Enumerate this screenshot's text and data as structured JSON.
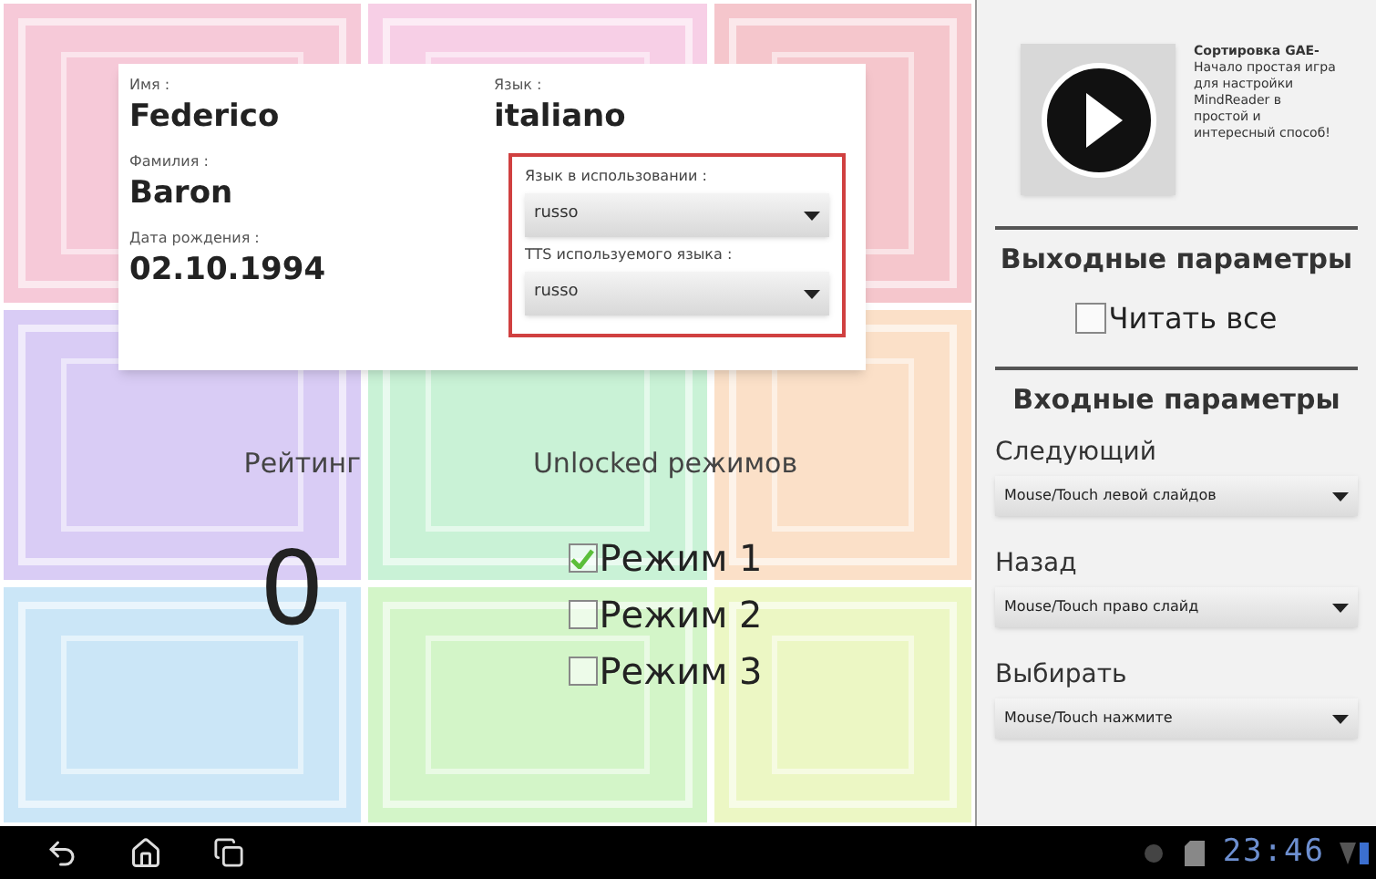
{
  "profile": {
    "fields": [
      {
        "label": "Имя :",
        "value": "Federico"
      },
      {
        "label": "Фамилия :",
        "value": "Baron"
      },
      {
        "label": "Дата рождения :",
        "value": "02.10.1994"
      }
    ],
    "language": {
      "label": "Язык :",
      "value": "italiano"
    },
    "language_settings": [
      {
        "label": "Язык в использовании :",
        "value": "russo"
      },
      {
        "label": "TTS используемого языка :",
        "value": "russo"
      }
    ]
  },
  "rating": {
    "label": "Рейтинг",
    "value": "0"
  },
  "modes": {
    "title": "Unlocked режимов",
    "items": [
      {
        "label": "Режим 1",
        "checked": true
      },
      {
        "label": "Режим 2",
        "checked": false
      },
      {
        "label": "Режим 3",
        "checked": false
      }
    ]
  },
  "sidebar": {
    "game": {
      "title": "Сортировка GAE-",
      "description": "Начало простая игра для настройки MindReader в простой и интересный способ!"
    },
    "output": {
      "title": "Выходные параметры",
      "read_all": {
        "label": "Читать все",
        "checked": false
      }
    },
    "input": {
      "title": "Входные параметры",
      "settings": [
        {
          "label": "Следующий",
          "value": "Mouse/Touch левой слайдов"
        },
        {
          "label": "Назад",
          "value": "Mouse/Touch право слайд"
        },
        {
          "label": "Выбирать",
          "value": "Mouse/Touch нажмите"
        }
      ]
    }
  },
  "status_bar": {
    "time": "23:46"
  }
}
